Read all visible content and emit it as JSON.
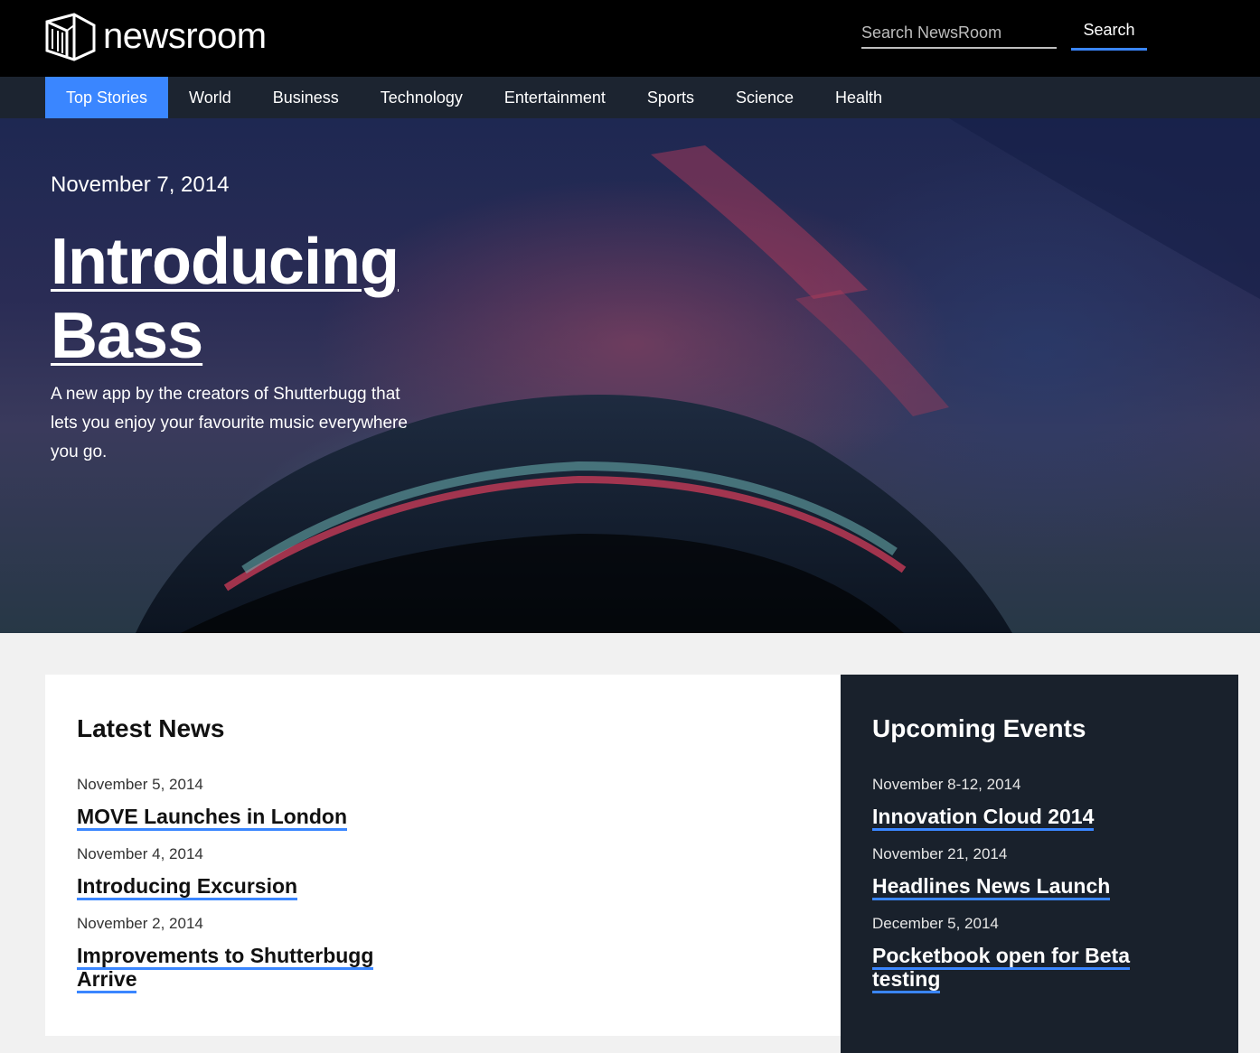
{
  "header": {
    "logo_text": "newsroom",
    "search_placeholder": "Search NewsRoom",
    "search_button": "Search"
  },
  "nav": {
    "items": [
      {
        "label": "Top Stories",
        "active": true
      },
      {
        "label": "World"
      },
      {
        "label": "Business"
      },
      {
        "label": "Technology"
      },
      {
        "label": "Entertainment"
      },
      {
        "label": "Sports"
      },
      {
        "label": "Science"
      },
      {
        "label": "Health"
      }
    ]
  },
  "hero": {
    "date": "November 7, 2014",
    "title": "Introducing Bass",
    "description": "A new app by the creators of Shutterbugg that lets you enjoy your favourite music everywhere you go."
  },
  "latest_news": {
    "title": "Latest News",
    "items": [
      {
        "date": "November 5, 2014",
        "title": "MOVE Launches in London"
      },
      {
        "date": "November 4, 2014",
        "title": "Introducing Excursion"
      },
      {
        "date": "November 2, 2014",
        "title": "Improvements to Shutterbugg Arrive"
      }
    ]
  },
  "upcoming_events": {
    "title": "Upcoming Events",
    "items": [
      {
        "date": "November 8-12, 2014",
        "title": "Innovation Cloud 2014"
      },
      {
        "date": "November 21, 2014",
        "title": "Headlines News Launch"
      },
      {
        "date": "December 5, 2014",
        "title": "Pocketbook open for Beta testing"
      }
    ]
  },
  "colors": {
    "accent": "#3a86ff",
    "header_bg": "#000000",
    "nav_bg": "#1c2430",
    "events_bg": "#19212c"
  }
}
